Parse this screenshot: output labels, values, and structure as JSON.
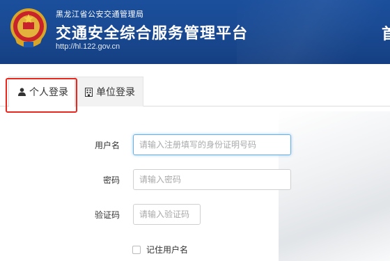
{
  "header": {
    "org_name": "黑龙江省公安交通管理局",
    "title": "交通安全综合服务管理平台",
    "url": "http://hl.122.gov.cn",
    "right_partial": "首"
  },
  "tabs": [
    {
      "label": "个人登录",
      "icon": "user-icon",
      "active": true
    },
    {
      "label": "单位登录",
      "icon": "building-icon",
      "active": false
    }
  ],
  "form": {
    "username_label": "用户名",
    "username_placeholder": "请输入注册填写的身份证明号码",
    "password_label": "密码",
    "password_placeholder": "请输入密码",
    "captcha_label": "验证码",
    "captcha_placeholder": "请输入验证码",
    "remember_label": "记住用户名"
  },
  "colors": {
    "header_bg": "#1a4a93",
    "highlight_border": "#e8281e",
    "focus_border": "#66afe9"
  }
}
